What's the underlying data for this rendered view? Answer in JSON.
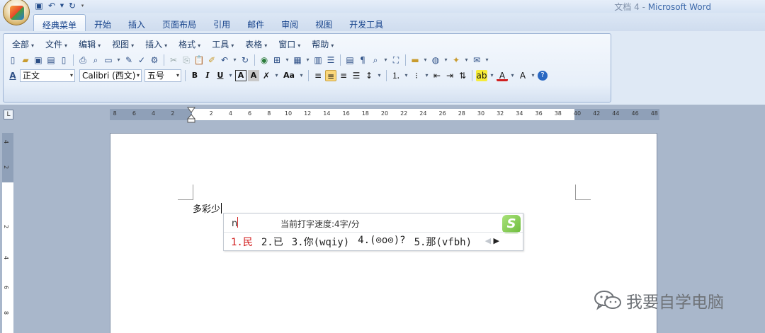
{
  "window": {
    "doc_name": "文档 4",
    "separator": " - ",
    "app_name": "Microsoft Word"
  },
  "quick_access": {
    "icons": [
      "save-icon",
      "undo-icon",
      "redo-icon",
      "customize-icon"
    ]
  },
  "tabs": [
    {
      "label": "经典菜单",
      "active": true
    },
    {
      "label": "开始"
    },
    {
      "label": "插入"
    },
    {
      "label": "页面布局"
    },
    {
      "label": "引用"
    },
    {
      "label": "邮件"
    },
    {
      "label": "审阅"
    },
    {
      "label": "视图"
    },
    {
      "label": "开发工具"
    }
  ],
  "menubar": [
    {
      "label": "全部"
    },
    {
      "label": "文件"
    },
    {
      "label": "编辑"
    },
    {
      "label": "视图"
    },
    {
      "label": "插入"
    },
    {
      "label": "格式"
    },
    {
      "label": "工具"
    },
    {
      "label": "表格"
    },
    {
      "label": "窗口"
    },
    {
      "label": "帮助"
    }
  ],
  "format_bar": {
    "style_value": "正文",
    "font_value": "Calibri (西文)",
    "size_value": "五号",
    "bold": "B",
    "italic": "I",
    "underline": "U",
    "char_border": "A",
    "char_shading": "A",
    "change_case": "Aa"
  },
  "ruler": {
    "left_numbers": [
      "8",
      "6",
      "4",
      "2"
    ],
    "right_numbers": [
      "2",
      "4",
      "6",
      "8",
      "10",
      "12",
      "14",
      "16",
      "18",
      "20",
      "22",
      "24",
      "26",
      "28",
      "30",
      "32",
      "34",
      "36",
      "38",
      "40",
      "42",
      "44",
      "46",
      "48"
    ],
    "vertical_numbers": [
      "4",
      "2",
      "2",
      "4",
      "6",
      "8"
    ]
  },
  "document": {
    "typed_text": "多彩少"
  },
  "ime": {
    "input": "n",
    "speed_text": "当前打字速度:4字/分",
    "logo": "S",
    "candidates": [
      "1.民",
      "2.已",
      "3.你(wqiy)",
      "4.(⊙o⊙)?",
      "5.那(vfbh)"
    ],
    "prev": "◀",
    "next": "▶"
  },
  "watermark": {
    "text": "我要自学电脑"
  },
  "colors": {
    "frame_bg": "#a9b7cb",
    "ribbon_bg": "#dfe9f5",
    "tab_text": "#15428b",
    "title_app": "#3e6aaa",
    "candidate_highlight": "#d01818"
  }
}
